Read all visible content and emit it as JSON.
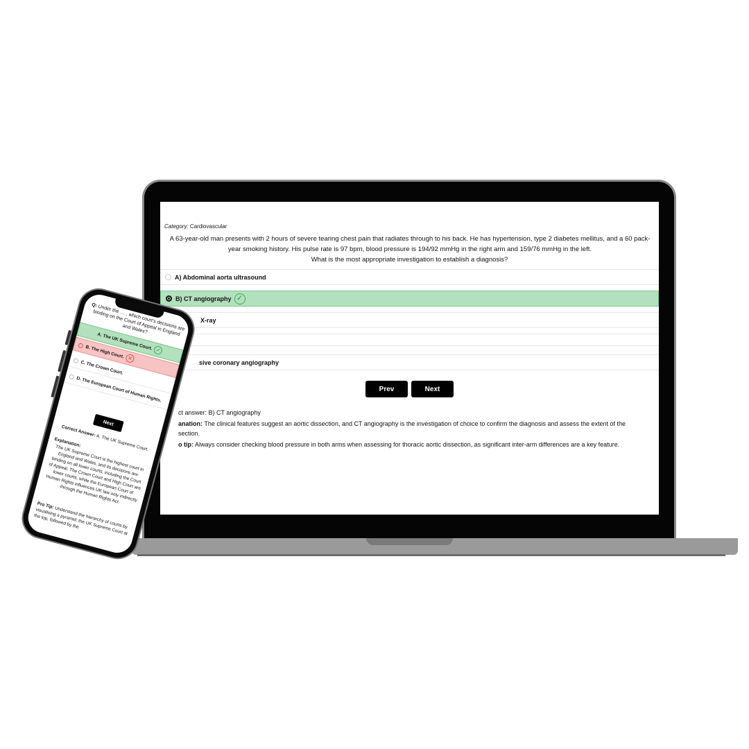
{
  "laptop": {
    "category_label": "Category:",
    "category_value": "Cardiovascular",
    "question": "A 63-year-old man presents with 2 hours of severe tearing chest pain that radiates through to his back. He has hypertension, type 2 diabetes mellitus, and a 60 pack-year smoking history. His pulse rate is 97 bpm, blood pressure is 194/92 mmHg in the right arm and 159/76 mmHg in the left.",
    "prompt": "What is the most appropriate investigation to establish a diagnosis?",
    "options": [
      {
        "label": "A) Abdominal aorta ultrasound",
        "state": "unselected"
      },
      {
        "label": "B) CT angiography",
        "state": "correct-selected"
      },
      {
        "label": "X-ray",
        "state": "unselected"
      },
      {
        "label": "",
        "state": "unselected"
      },
      {
        "label": "sive coronary angiography",
        "state": "unselected"
      }
    ],
    "prev_label": "Prev",
    "next_label": "Next",
    "correct_answer_label": "ct answer:",
    "correct_answer_value": "B) CT angiography",
    "explanation_label": "anation:",
    "explanation_text": "The clinical features suggest an aortic dissection, and CT angiography is the investigation of choice to confirm the diagnosis and assess the extent of the",
    "explanation_cont": "section.",
    "pro_tip_label": "o tip:",
    "pro_tip_text": "Always consider checking blood pressure in both arms when assessing for thoracic aortic dissection, as significant inter-arm differences are a key feature."
  },
  "phone": {
    "question_label": "Q:",
    "question": "Under the … , which court's decisions are binding on the Court of Appeal in England and Wales?",
    "options": [
      {
        "label": "A. The UK Supreme Court.",
        "state": "correct"
      },
      {
        "label": "B. The High Court.",
        "state": "wrong-selected"
      },
      {
        "label": "C. The Crown Court.",
        "state": "unselected"
      },
      {
        "label": "D. The European Court of Human Rights.",
        "state": "unselected"
      }
    ],
    "next_label": "Next",
    "correct_answer_label": "Correct Answer:",
    "correct_answer_value": "A. The UK Supreme Court.",
    "explanation_label": "Explanation:",
    "explanation_text": "The UK Supreme Court is the highest court in England and Wales, and its decisions are binding on all lower courts, including the Court of Appeal. The Crown Court and High Court are lower courts, while the European Court of Human Rights influences UK law only indirectly through the Human Rights Act.",
    "pro_tip_label": "Pro Tip:",
    "pro_tip_text": "Understand the hierarchy of courts by visualising a pyramid: the UK Supreme Court at the top, followed by the"
  },
  "colors": {
    "correct_bg": "#b3e0bd",
    "wrong_bg": "#f7c4c4",
    "check_green": "#3cac55",
    "cross_red": "#d9534f"
  }
}
